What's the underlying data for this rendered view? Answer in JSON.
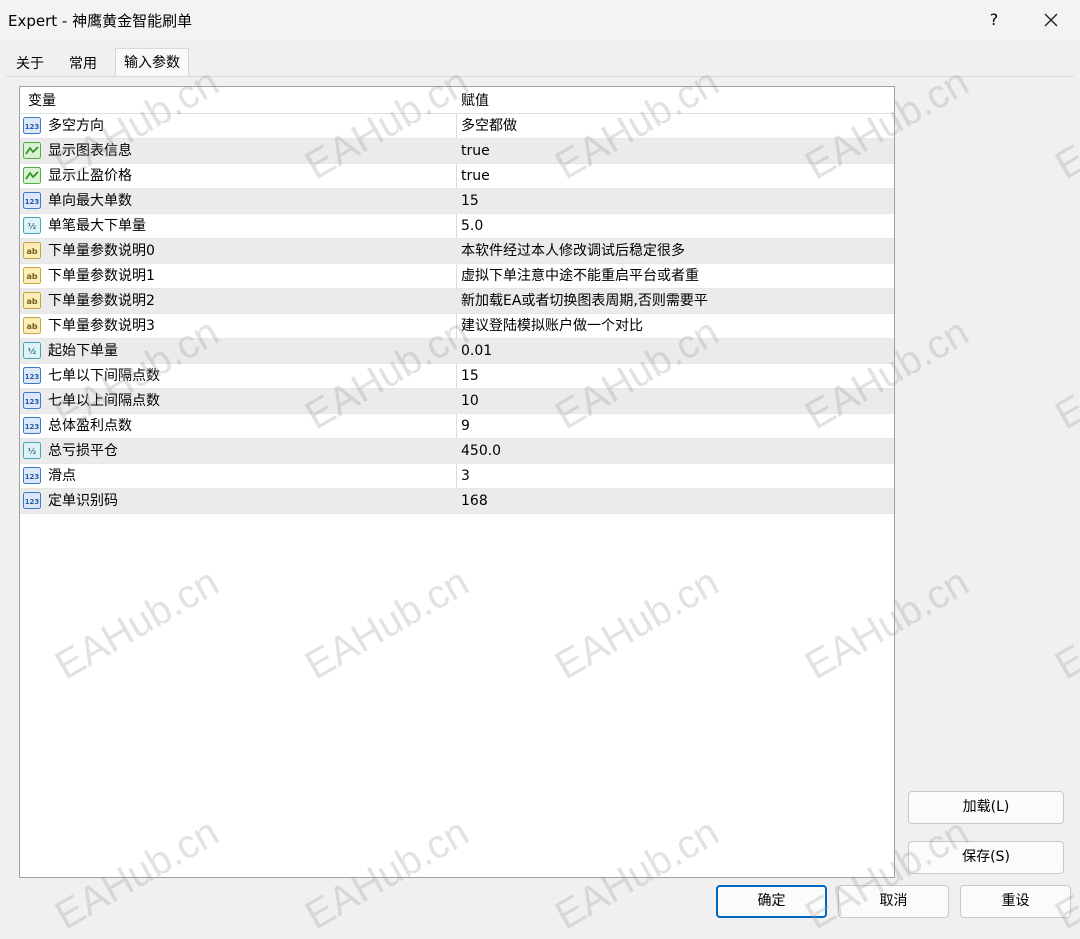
{
  "window": {
    "title": "Expert - 神鹰黄金智能刷单",
    "help": "?"
  },
  "tabs": [
    {
      "label": "关于"
    },
    {
      "label": "常用"
    },
    {
      "label": "输入参数"
    }
  ],
  "grid": {
    "headers": {
      "variable": "变量",
      "value": "赋值"
    },
    "rows": [
      {
        "icon": "int",
        "name": "多空方向",
        "value": "多空都做"
      },
      {
        "icon": "bool",
        "name": "显示图表信息",
        "value": "true"
      },
      {
        "icon": "bool",
        "name": "显示止盈价格",
        "value": "true"
      },
      {
        "icon": "int",
        "name": "单向最大单数",
        "value": "15"
      },
      {
        "icon": "double",
        "name": "单笔最大下单量",
        "value": "5.0"
      },
      {
        "icon": "string",
        "name": "下单量参数说明0",
        "value": "本软件经过本人修改调试后稳定很多"
      },
      {
        "icon": "string",
        "name": "下单量参数说明1",
        "value": "虚拟下单注意中途不能重启平台或者重"
      },
      {
        "icon": "string",
        "name": "下单量参数说明2",
        "value": "新加载EA或者切换图表周期,否则需要平"
      },
      {
        "icon": "string",
        "name": "下单量参数说明3",
        "value": "建议登陆模拟账户做一个对比"
      },
      {
        "icon": "double",
        "name": "起始下单量",
        "value": "0.01"
      },
      {
        "icon": "int",
        "name": "七单以下间隔点数",
        "value": "15"
      },
      {
        "icon": "int",
        "name": "七单以上间隔点数",
        "value": "10"
      },
      {
        "icon": "int",
        "name": "总体盈利点数",
        "value": "9"
      },
      {
        "icon": "double",
        "name": "总亏损平仓",
        "value": "450.0"
      },
      {
        "icon": "int",
        "name": "滑点",
        "value": "3"
      },
      {
        "icon": "int",
        "name": "定单识别码",
        "value": "168"
      }
    ]
  },
  "side_buttons": {
    "load": "加载(L)",
    "save": "保存(S)"
  },
  "footer_buttons": {
    "ok": "确定",
    "cancel": "取消",
    "reset": "重设"
  },
  "watermark": "EAHub.cn",
  "colors": {
    "accent": "#0067c0",
    "alt_row": "#ebebeb",
    "bool_icon": "#5cc84a",
    "int_icon": "#3a78c8",
    "string_icon": "#e8c34a"
  }
}
